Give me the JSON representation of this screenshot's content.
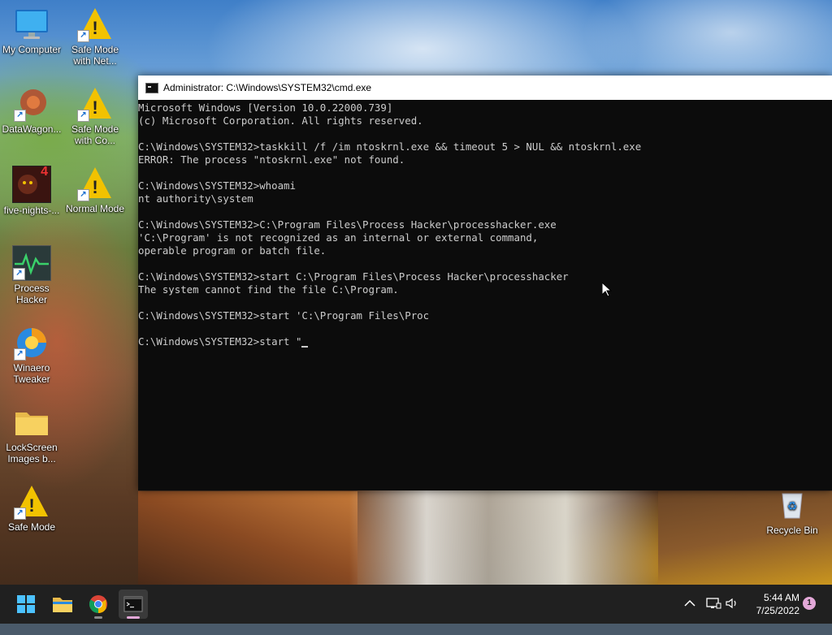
{
  "desktop": {
    "icons": [
      {
        "label1": "My Computer",
        "label2": "",
        "icon": "monitor-icon"
      },
      {
        "label1": "Safe Mode",
        "label2": "with Net...",
        "icon": "warning-icon"
      },
      {
        "label1": "DataWagon...",
        "label2": "",
        "icon": "app-icon"
      },
      {
        "label1": "Safe Mode",
        "label2": "with Co...",
        "icon": "warning-icon"
      },
      {
        "label1": "five-nights-...",
        "label2": "",
        "icon": "game-icon"
      },
      {
        "label1": "Normal Mode",
        "label2": "",
        "icon": "warning-icon"
      },
      {
        "label1": "Process",
        "label2": "Hacker",
        "icon": "process-hacker-icon"
      },
      {
        "label1": "Winaero",
        "label2": "Tweaker",
        "icon": "winaero-icon"
      },
      {
        "label1": "LockScreen",
        "label2": "Images b...",
        "icon": "folder-icon"
      },
      {
        "label1": "Safe Mode",
        "label2": "",
        "icon": "warning-icon"
      },
      {
        "label1": "Recycle Bin",
        "label2": "",
        "icon": "recycle-bin-icon"
      }
    ],
    "game_badge": "4"
  },
  "cmd_window": {
    "title": "Administrator: C:\\Windows\\SYSTEM32\\cmd.exe",
    "lines": [
      "Microsoft Windows [Version 10.0.22000.739]",
      "(c) Microsoft Corporation. All rights reserved.",
      "",
      "C:\\Windows\\SYSTEM32>taskkill /f /im ntoskrnl.exe && timeout 5 > NUL && ntoskrnl.exe",
      "ERROR: The process \"ntoskrnl.exe\" not found.",
      "",
      "C:\\Windows\\SYSTEM32>whoami",
      "nt authority\\system",
      "",
      "C:\\Windows\\SYSTEM32>C:\\Program Files\\Process Hacker\\processhacker.exe",
      "'C:\\Program' is not recognized as an internal or external command,",
      "operable program or batch file.",
      "",
      "C:\\Windows\\SYSTEM32>start C:\\Program Files\\Process Hacker\\processhacker",
      "The system cannot find the file C:\\Program.",
      "",
      "C:\\Windows\\SYSTEM32>start 'C:\\Program Files\\Proc",
      "",
      "C:\\Windows\\SYSTEM32>start \""
    ]
  },
  "taskbar": {
    "apps": [
      {
        "name": "start-button",
        "icon": "windows-logo-icon"
      },
      {
        "name": "file-explorer",
        "icon": "folder-icon"
      },
      {
        "name": "chrome",
        "icon": "chrome-icon"
      },
      {
        "name": "cmd",
        "icon": "terminal-icon"
      }
    ],
    "clock_time": "5:44 AM",
    "clock_date": "7/25/2022",
    "notification_count": "1"
  },
  "colors": {
    "console_bg": "#0c0c0c",
    "console_text": "#cccccc",
    "taskbar_bg": "#202020",
    "accent": "#e3a8d8",
    "warning": "#f2c200"
  }
}
